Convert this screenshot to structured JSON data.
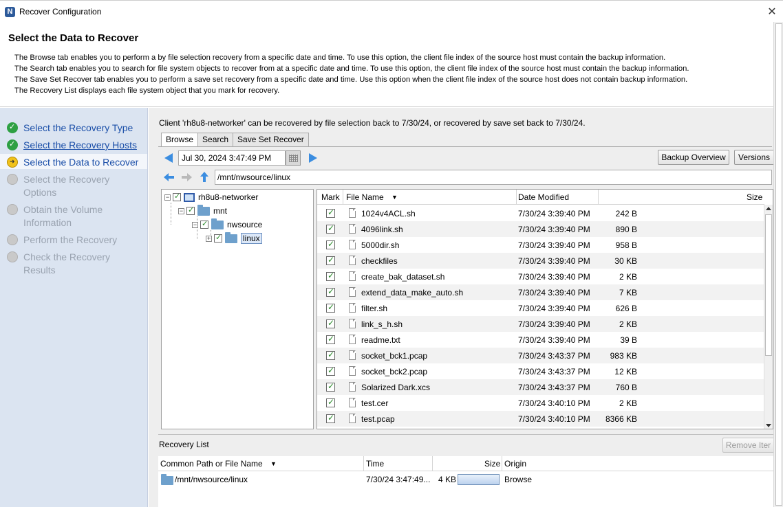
{
  "window": {
    "title": "Recover Configuration",
    "close_glyph": "✕"
  },
  "header": {
    "title": "Select the Data to Recover",
    "desc_lines": [
      "The Browse tab enables you to perform a by file selection recovery from a specific date and time. To use this option, the client file index of the source host must contain the backup information.",
      "The Search tab enables you to search for file system objects to recover from at a specific date and time. To use this option, the client file index of the source host must contain the backup information.",
      "The Save Set Recover tab enables you to perform a save set recovery from a specific date and time.  Use this option when the client file index of the source host does not contain backup information.",
      "The Recovery List displays each file system object that you mark for recovery."
    ]
  },
  "steps": [
    {
      "label": "Select the Recovery Type",
      "state": "done"
    },
    {
      "label": "Select the Recovery Hosts",
      "state": "done-link"
    },
    {
      "label": "Select the Data to Recover",
      "state": "current"
    },
    {
      "label": "Select the Recovery Options",
      "state": "todo"
    },
    {
      "label": "Obtain the Volume Information",
      "state": "todo"
    },
    {
      "label": "Perform the Recovery",
      "state": "todo"
    },
    {
      "label": "Check the Recovery Results",
      "state": "todo"
    }
  ],
  "main": {
    "info": "Client 'rh8u8-networker' can be recovered by file selection back to 7/30/24, or recovered by save set back to 7/30/24.",
    "tabs": [
      "Browse",
      "Search",
      "Save Set Recover"
    ],
    "active_tab": "Browse",
    "date_value": "Jul 30, 2024 3:47:49 PM",
    "backup_overview_label": "Backup Overview",
    "versions_label": "Versions",
    "path_value": "/mnt/nwsource/linux"
  },
  "tree": {
    "root": "rh8u8-networker",
    "mnt": "mnt",
    "nwsource": "nwsource",
    "linux": "linux"
  },
  "files": {
    "headers": {
      "mark": "Mark",
      "name": "File Name",
      "date": "Date Modified",
      "size": "Size"
    },
    "rows": [
      {
        "name": "1024v4ACL.sh",
        "date": "7/30/24 3:39:40 PM",
        "size": "242 B"
      },
      {
        "name": "4096link.sh",
        "date": "7/30/24 3:39:40 PM",
        "size": "890 B"
      },
      {
        "name": "5000dir.sh",
        "date": "7/30/24 3:39:40 PM",
        "size": "958 B"
      },
      {
        "name": "checkfiles",
        "date": "7/30/24 3:39:40 PM",
        "size": "30 KB"
      },
      {
        "name": "create_bak_dataset.sh",
        "date": "7/30/24 3:39:40 PM",
        "size": "2 KB"
      },
      {
        "name": "extend_data_make_auto.sh",
        "date": "7/30/24 3:39:40 PM",
        "size": "7 KB"
      },
      {
        "name": "filter.sh",
        "date": "7/30/24 3:39:40 PM",
        "size": "626 B"
      },
      {
        "name": "link_s_h.sh",
        "date": "7/30/24 3:39:40 PM",
        "size": "2 KB"
      },
      {
        "name": "readme.txt",
        "date": "7/30/24 3:39:40 PM",
        "size": "39 B"
      },
      {
        "name": "socket_bck1.pcap",
        "date": "7/30/24 3:43:37 PM",
        "size": "983 KB"
      },
      {
        "name": "socket_bck2.pcap",
        "date": "7/30/24 3:43:37 PM",
        "size": "12 KB"
      },
      {
        "name": "Solarized Dark.xcs",
        "date": "7/30/24 3:43:37 PM",
        "size": "760 B"
      },
      {
        "name": "test.cer",
        "date": "7/30/24 3:40:10 PM",
        "size": "2 KB"
      },
      {
        "name": "test.pcap",
        "date": "7/30/24 3:40:10 PM",
        "size": "8366 KB"
      }
    ]
  },
  "recovery_list": {
    "title": "Recovery List",
    "remove_label": "Remove Iter",
    "headers": {
      "path": "Common Path or File Name",
      "time": "Time",
      "size": "Size",
      "origin": "Origin"
    },
    "row": {
      "path": "/mnt/nwsource/linux",
      "time": "7/30/24 3:47:49...",
      "size": "4 KB",
      "origin": "Browse"
    }
  }
}
